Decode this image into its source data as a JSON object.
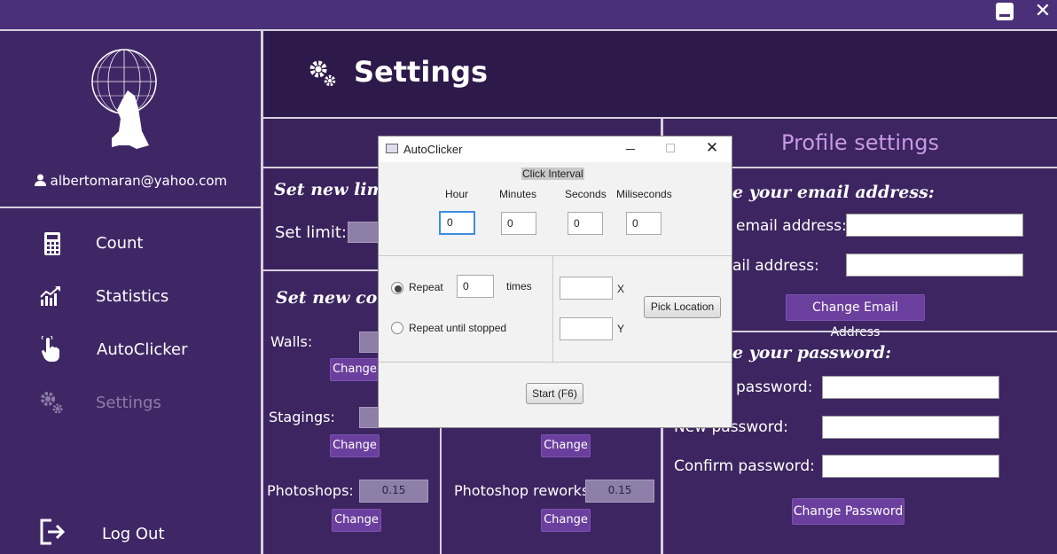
{
  "window": {
    "minimize_icon": "minimize-icon",
    "close_label": "✕"
  },
  "sidebar": {
    "user_email": "albertomaran@yahoo.com",
    "items": [
      {
        "label": "Count",
        "icon": "calculator-icon"
      },
      {
        "label": "Statistics",
        "icon": "chart-icon"
      },
      {
        "label": "AutoClicker",
        "icon": "pointer-hand-icon"
      },
      {
        "label": "Settings",
        "icon": "gears-icon"
      }
    ],
    "logout_label": "Log Out"
  },
  "header": {
    "title": "Settings"
  },
  "limit_section": {
    "title": "Set new limi",
    "set_limit_label": "Set limit:"
  },
  "coef_section": {
    "title": "Set new coef",
    "walls_label": "Walls:",
    "stagings_label": "Stagings:",
    "photoshops_label": "Photoshops:",
    "photoshops_value": "0.15",
    "photoshop_reworks_label": "Photoshop reworks:",
    "photoshop_reworks_value": "0.15",
    "change_label": "Change"
  },
  "profile": {
    "title": "Profile settings",
    "email_section_title": "e your email address:",
    "current_email_label": "email address:",
    "new_email_label": "ail address:",
    "change_email_button": "Change Email Address",
    "password_section_title": "e your password:",
    "old_password_label": "password:",
    "new_password_label": "New password:",
    "confirm_password_label": "Confirm password:",
    "change_password_button": "Change Password"
  },
  "dialog": {
    "title": "AutoClicker",
    "click_interval_label": "Click Interval",
    "hour_label": "Hour",
    "hour_value": "0",
    "minutes_label": "Minutes",
    "minutes_value": "0",
    "seconds_label": "Seconds",
    "seconds_value": "0",
    "miliseconds_label": "Miliseconds",
    "miliseconds_value": "0",
    "repeat_label": "Repeat",
    "repeat_value": "0",
    "times_label": "times",
    "repeat_until_label": "Repeat until stopped",
    "x_label": "X",
    "y_label": "Y",
    "pick_location_button": "Pick Location",
    "start_button": "Start (F6)"
  }
}
